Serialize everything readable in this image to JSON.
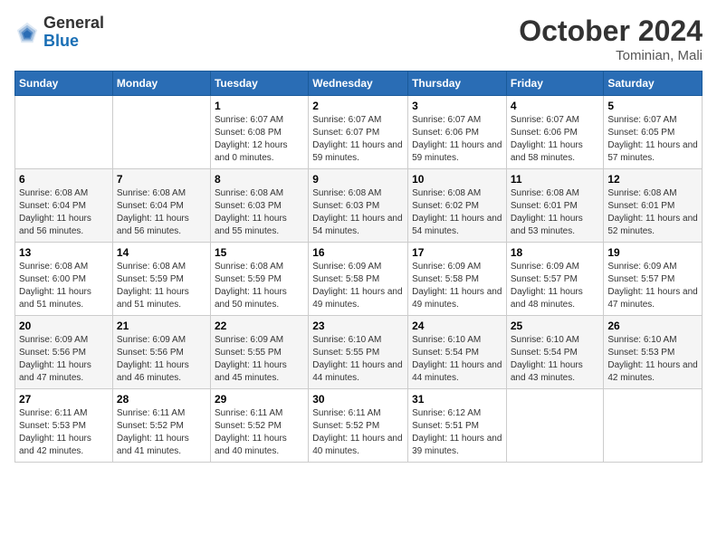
{
  "logo": {
    "general": "General",
    "blue": "Blue"
  },
  "header": {
    "month_year": "October 2024",
    "location": "Tominian, Mali"
  },
  "weekdays": [
    "Sunday",
    "Monday",
    "Tuesday",
    "Wednesday",
    "Thursday",
    "Friday",
    "Saturday"
  ],
  "weeks": [
    [
      {
        "day": "",
        "sunrise": "",
        "sunset": "",
        "daylight": ""
      },
      {
        "day": "",
        "sunrise": "",
        "sunset": "",
        "daylight": ""
      },
      {
        "day": "1",
        "sunrise": "Sunrise: 6:07 AM",
        "sunset": "Sunset: 6:08 PM",
        "daylight": "Daylight: 12 hours and 0 minutes."
      },
      {
        "day": "2",
        "sunrise": "Sunrise: 6:07 AM",
        "sunset": "Sunset: 6:07 PM",
        "daylight": "Daylight: 11 hours and 59 minutes."
      },
      {
        "day": "3",
        "sunrise": "Sunrise: 6:07 AM",
        "sunset": "Sunset: 6:06 PM",
        "daylight": "Daylight: 11 hours and 59 minutes."
      },
      {
        "day": "4",
        "sunrise": "Sunrise: 6:07 AM",
        "sunset": "Sunset: 6:06 PM",
        "daylight": "Daylight: 11 hours and 58 minutes."
      },
      {
        "day": "5",
        "sunrise": "Sunrise: 6:07 AM",
        "sunset": "Sunset: 6:05 PM",
        "daylight": "Daylight: 11 hours and 57 minutes."
      }
    ],
    [
      {
        "day": "6",
        "sunrise": "Sunrise: 6:08 AM",
        "sunset": "Sunset: 6:04 PM",
        "daylight": "Daylight: 11 hours and 56 minutes."
      },
      {
        "day": "7",
        "sunrise": "Sunrise: 6:08 AM",
        "sunset": "Sunset: 6:04 PM",
        "daylight": "Daylight: 11 hours and 56 minutes."
      },
      {
        "day": "8",
        "sunrise": "Sunrise: 6:08 AM",
        "sunset": "Sunset: 6:03 PM",
        "daylight": "Daylight: 11 hours and 55 minutes."
      },
      {
        "day": "9",
        "sunrise": "Sunrise: 6:08 AM",
        "sunset": "Sunset: 6:03 PM",
        "daylight": "Daylight: 11 hours and 54 minutes."
      },
      {
        "day": "10",
        "sunrise": "Sunrise: 6:08 AM",
        "sunset": "Sunset: 6:02 PM",
        "daylight": "Daylight: 11 hours and 54 minutes."
      },
      {
        "day": "11",
        "sunrise": "Sunrise: 6:08 AM",
        "sunset": "Sunset: 6:01 PM",
        "daylight": "Daylight: 11 hours and 53 minutes."
      },
      {
        "day": "12",
        "sunrise": "Sunrise: 6:08 AM",
        "sunset": "Sunset: 6:01 PM",
        "daylight": "Daylight: 11 hours and 52 minutes."
      }
    ],
    [
      {
        "day": "13",
        "sunrise": "Sunrise: 6:08 AM",
        "sunset": "Sunset: 6:00 PM",
        "daylight": "Daylight: 11 hours and 51 minutes."
      },
      {
        "day": "14",
        "sunrise": "Sunrise: 6:08 AM",
        "sunset": "Sunset: 5:59 PM",
        "daylight": "Daylight: 11 hours and 51 minutes."
      },
      {
        "day": "15",
        "sunrise": "Sunrise: 6:08 AM",
        "sunset": "Sunset: 5:59 PM",
        "daylight": "Daylight: 11 hours and 50 minutes."
      },
      {
        "day": "16",
        "sunrise": "Sunrise: 6:09 AM",
        "sunset": "Sunset: 5:58 PM",
        "daylight": "Daylight: 11 hours and 49 minutes."
      },
      {
        "day": "17",
        "sunrise": "Sunrise: 6:09 AM",
        "sunset": "Sunset: 5:58 PM",
        "daylight": "Daylight: 11 hours and 49 minutes."
      },
      {
        "day": "18",
        "sunrise": "Sunrise: 6:09 AM",
        "sunset": "Sunset: 5:57 PM",
        "daylight": "Daylight: 11 hours and 48 minutes."
      },
      {
        "day": "19",
        "sunrise": "Sunrise: 6:09 AM",
        "sunset": "Sunset: 5:57 PM",
        "daylight": "Daylight: 11 hours and 47 minutes."
      }
    ],
    [
      {
        "day": "20",
        "sunrise": "Sunrise: 6:09 AM",
        "sunset": "Sunset: 5:56 PM",
        "daylight": "Daylight: 11 hours and 47 minutes."
      },
      {
        "day": "21",
        "sunrise": "Sunrise: 6:09 AM",
        "sunset": "Sunset: 5:56 PM",
        "daylight": "Daylight: 11 hours and 46 minutes."
      },
      {
        "day": "22",
        "sunrise": "Sunrise: 6:09 AM",
        "sunset": "Sunset: 5:55 PM",
        "daylight": "Daylight: 11 hours and 45 minutes."
      },
      {
        "day": "23",
        "sunrise": "Sunrise: 6:10 AM",
        "sunset": "Sunset: 5:55 PM",
        "daylight": "Daylight: 11 hours and 44 minutes."
      },
      {
        "day": "24",
        "sunrise": "Sunrise: 6:10 AM",
        "sunset": "Sunset: 5:54 PM",
        "daylight": "Daylight: 11 hours and 44 minutes."
      },
      {
        "day": "25",
        "sunrise": "Sunrise: 6:10 AM",
        "sunset": "Sunset: 5:54 PM",
        "daylight": "Daylight: 11 hours and 43 minutes."
      },
      {
        "day": "26",
        "sunrise": "Sunrise: 6:10 AM",
        "sunset": "Sunset: 5:53 PM",
        "daylight": "Daylight: 11 hours and 42 minutes."
      }
    ],
    [
      {
        "day": "27",
        "sunrise": "Sunrise: 6:11 AM",
        "sunset": "Sunset: 5:53 PM",
        "daylight": "Daylight: 11 hours and 42 minutes."
      },
      {
        "day": "28",
        "sunrise": "Sunrise: 6:11 AM",
        "sunset": "Sunset: 5:52 PM",
        "daylight": "Daylight: 11 hours and 41 minutes."
      },
      {
        "day": "29",
        "sunrise": "Sunrise: 6:11 AM",
        "sunset": "Sunset: 5:52 PM",
        "daylight": "Daylight: 11 hours and 40 minutes."
      },
      {
        "day": "30",
        "sunrise": "Sunrise: 6:11 AM",
        "sunset": "Sunset: 5:52 PM",
        "daylight": "Daylight: 11 hours and 40 minutes."
      },
      {
        "day": "31",
        "sunrise": "Sunrise: 6:12 AM",
        "sunset": "Sunset: 5:51 PM",
        "daylight": "Daylight: 11 hours and 39 minutes."
      },
      {
        "day": "",
        "sunrise": "",
        "sunset": "",
        "daylight": ""
      },
      {
        "day": "",
        "sunrise": "",
        "sunset": "",
        "daylight": ""
      }
    ]
  ]
}
